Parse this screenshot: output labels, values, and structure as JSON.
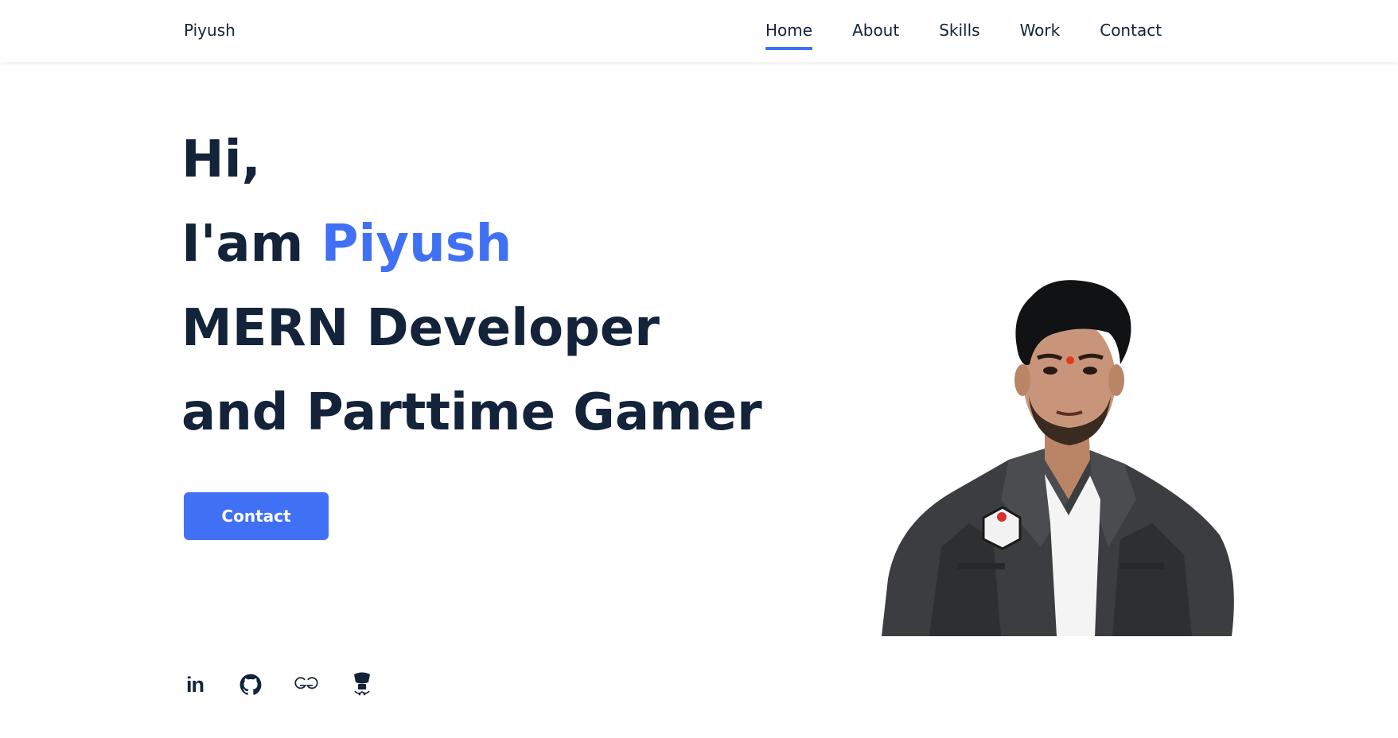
{
  "header": {
    "logo": "Piyush",
    "nav": [
      {
        "label": "Home",
        "active": true
      },
      {
        "label": "About",
        "active": false
      },
      {
        "label": "Skills",
        "active": false
      },
      {
        "label": "Work",
        "active": false
      },
      {
        "label": "Contact",
        "active": false
      }
    ]
  },
  "hero": {
    "line1": "Hi,",
    "line2_prefix": "I'am ",
    "line2_name": "Piyush",
    "line3": "MERN Developer",
    "line4": "and Parttime Gamer",
    "cta_label": "Contact"
  },
  "social": [
    {
      "icon": "linkedin-icon",
      "glyph": "in"
    },
    {
      "icon": "github-icon"
    },
    {
      "icon": "geeksforgeeks-icon"
    },
    {
      "icon": "codechef-icon"
    }
  ],
  "colors": {
    "accent": "#4070f4",
    "text": "#12233a",
    "background": "#ffffff"
  }
}
